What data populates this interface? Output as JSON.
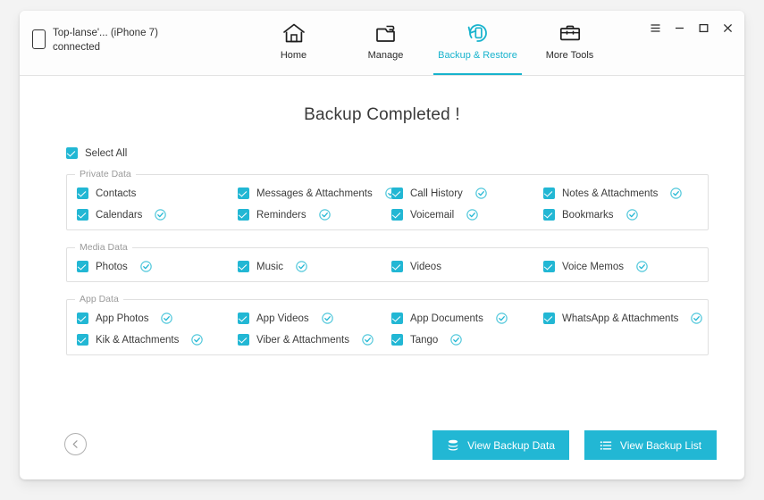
{
  "window": {
    "device": {
      "icon": "phone-icon",
      "name": "Top-lanse'... (iPhone 7)",
      "status": "connected"
    },
    "controls": [
      {
        "name": "menu-icon",
        "glyph": "☰"
      },
      {
        "name": "minimize-icon",
        "glyph": "‒"
      },
      {
        "name": "maximize-icon",
        "glyph": "☐"
      },
      {
        "name": "close-icon",
        "glyph": "✕"
      }
    ],
    "nav": [
      {
        "id": "home",
        "label": "Home",
        "icon": "home-icon",
        "active": false
      },
      {
        "id": "manage",
        "label": "Manage",
        "icon": "folder-icon",
        "active": false
      },
      {
        "id": "backup-restore",
        "label": "Backup & Restore",
        "icon": "backup-restore-icon",
        "active": true
      },
      {
        "id": "more-tools",
        "label": "More Tools",
        "icon": "toolbox-icon",
        "active": false
      }
    ]
  },
  "main": {
    "page_title": "Backup Completed !",
    "select_all": {
      "label": "Select All",
      "checked": true
    },
    "groups": [
      {
        "id": "private-data",
        "legend": "Private Data",
        "items": [
          {
            "label": "Contacts",
            "checked": true,
            "done": false
          },
          {
            "label": "Messages & Attachments",
            "checked": true,
            "done": true
          },
          {
            "label": "Call History",
            "checked": true,
            "done": true
          },
          {
            "label": "Notes & Attachments",
            "checked": true,
            "done": true
          },
          {
            "label": "Calendars",
            "checked": true,
            "done": true
          },
          {
            "label": "Reminders",
            "checked": true,
            "done": true
          },
          {
            "label": "Voicemail",
            "checked": true,
            "done": true
          },
          {
            "label": "Bookmarks",
            "checked": true,
            "done": true
          }
        ]
      },
      {
        "id": "media-data",
        "legend": "Media Data",
        "items": [
          {
            "label": "Photos",
            "checked": true,
            "done": true
          },
          {
            "label": "Music",
            "checked": true,
            "done": true
          },
          {
            "label": "Videos",
            "checked": true,
            "done": false
          },
          {
            "label": "Voice Memos",
            "checked": true,
            "done": true
          }
        ]
      },
      {
        "id": "app-data",
        "legend": "App Data",
        "items": [
          {
            "label": "App Photos",
            "checked": true,
            "done": true
          },
          {
            "label": "App Videos",
            "checked": true,
            "done": true
          },
          {
            "label": "App Documents",
            "checked": true,
            "done": true
          },
          {
            "label": "WhatsApp & Attachments",
            "checked": true,
            "done": true
          },
          {
            "label": "Kik & Attachments",
            "checked": true,
            "done": true
          },
          {
            "label": "Viber & Attachments",
            "checked": true,
            "done": true
          },
          {
            "label": "Tango",
            "checked": true,
            "done": true
          }
        ]
      }
    ]
  },
  "footer": {
    "back": {
      "name": "back-button",
      "icon": "chevron-left-icon"
    },
    "buttons": [
      {
        "id": "view-backup-data",
        "label": "View Backup Data",
        "icon": "database-icon"
      },
      {
        "id": "view-backup-list",
        "label": "View Backup List",
        "icon": "list-icon"
      }
    ]
  },
  "colors": {
    "accent": "#22b7d4",
    "accent_text": "#17b3cd",
    "text": "#3c3c3c",
    "legend": "#9a9a9a",
    "window_bg": "#ffffff",
    "page_bg": "#f3f3f3"
  }
}
